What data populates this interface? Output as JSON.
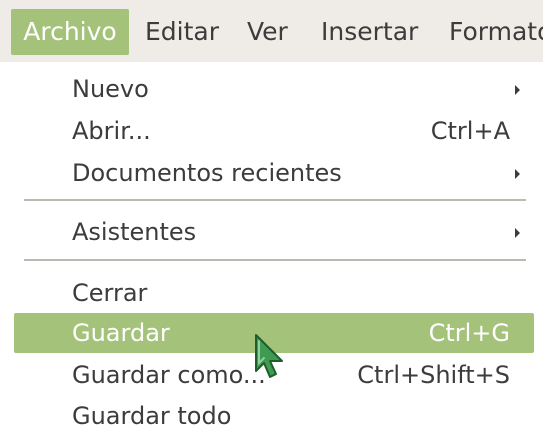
{
  "menubar": {
    "items": [
      {
        "label": "Archivo",
        "active": true
      },
      {
        "label": "Editar"
      },
      {
        "label": "Ver"
      },
      {
        "label": "Insertar"
      },
      {
        "label": "Formato"
      }
    ]
  },
  "menu": {
    "items": [
      {
        "label": "Nuevo",
        "submenu": true
      },
      {
        "label": "Abrir...",
        "accelerator": "Ctrl+A"
      },
      {
        "label": "Documentos recientes",
        "submenu": true
      },
      {
        "label": "Asistentes",
        "submenu": true
      },
      {
        "label": "Cerrar"
      },
      {
        "label": "Guardar",
        "accelerator": "Ctrl+G",
        "highlighted": true
      },
      {
        "label": "Guardar como...",
        "accelerator": "Ctrl+Shift+S"
      },
      {
        "label": "Guardar todo"
      }
    ]
  },
  "colors": {
    "highlight": "#a5c27a",
    "menubar_bg": "#efebe6",
    "text": "#3c3c3c",
    "cursor": "#3f9b52"
  },
  "icons": {
    "submenu_arrow": "chevron-right-icon",
    "pointer": "mouse-cursor-icon"
  }
}
